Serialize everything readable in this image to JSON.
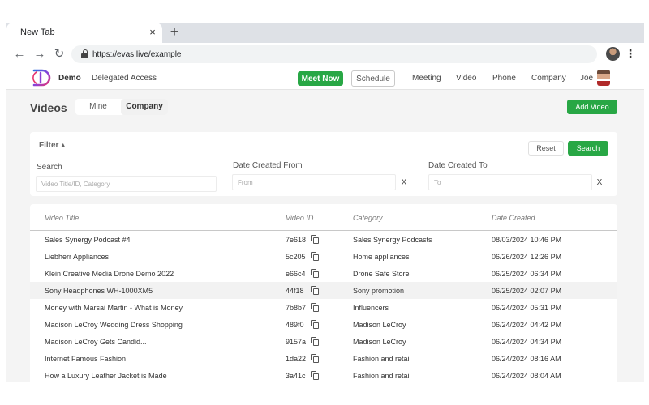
{
  "browser": {
    "tab_title": "New Tab",
    "tab_close": "×",
    "new_tab": "+",
    "back": "←",
    "forward": "→",
    "reload": "↻",
    "url": "https://evas.live/example",
    "menu": "⋮"
  },
  "header": {
    "brand": "Demo",
    "delegated": "Delegated Access",
    "meet_now": "Meet Now",
    "schedule": "Schedule",
    "nav": [
      "Meeting",
      "Video",
      "Phone",
      "Company"
    ],
    "user": "Joe"
  },
  "page": {
    "title": "Videos",
    "seg_mine": "Mine",
    "seg_company": "Company",
    "add_video": "Add Video"
  },
  "filter": {
    "toggle": "Filter ▴",
    "reset": "Reset",
    "search_btn": "Search",
    "search_label": "Search",
    "search_placeholder": "Video Title/ID, Category",
    "from_label": "Date Created From",
    "from_placeholder": "From",
    "to_label": "Date Created To",
    "to_placeholder": "To",
    "clear": "X"
  },
  "table": {
    "columns": [
      "Video Title",
      "Video ID",
      "Category",
      "Date Created"
    ],
    "rows": [
      {
        "title": "Sales Synergy Podcast #4",
        "id": "7e618",
        "category": "Sales Synergy Podcasts",
        "date": "08/03/2024 10:46 PM"
      },
      {
        "title": "Liebherr Appliances",
        "id": "5c205",
        "category": "Home appliances",
        "date": "06/26/2024 12:26 PM"
      },
      {
        "title": "Klein Creative Media Drone Demo 2022",
        "id": "e66c4",
        "category": "Drone Safe Store",
        "date": "06/25/2024 06:34 PM"
      },
      {
        "title": "Sony Headphones WH-1000XM5",
        "id": "44f18",
        "category": "Sony promotion",
        "date": "06/25/2024 02:07 PM"
      },
      {
        "title": "Money with Marsai Martin - What is Money",
        "id": "7b8b7",
        "category": "Influencers",
        "date": "06/24/2024 05:31 PM"
      },
      {
        "title": "Madison LeCroy Wedding Dress Shopping",
        "id": "489f0",
        "category": "Madison LeCroy",
        "date": "06/24/2024 04:42 PM"
      },
      {
        "title": "Madison LeCroy Gets Candid...",
        "id": "9157a",
        "category": "Madison LeCroy",
        "date": "06/24/2024 04:34 PM"
      },
      {
        "title": "Internet Famous Fashion",
        "id": "1da22",
        "category": "Fashion and retail",
        "date": "06/24/2024 08:16 AM"
      },
      {
        "title": "How a Luxury Leather Jacket is Made",
        "id": "3a41c",
        "category": "Fashion and retail",
        "date": "06/24/2024 08:04 AM"
      }
    ]
  },
  "colors": {
    "accent_green": "#28a745",
    "logo_blue": "#2f6fe0",
    "logo_purple": "#8e3fd6",
    "logo_pink": "#e8336e"
  }
}
